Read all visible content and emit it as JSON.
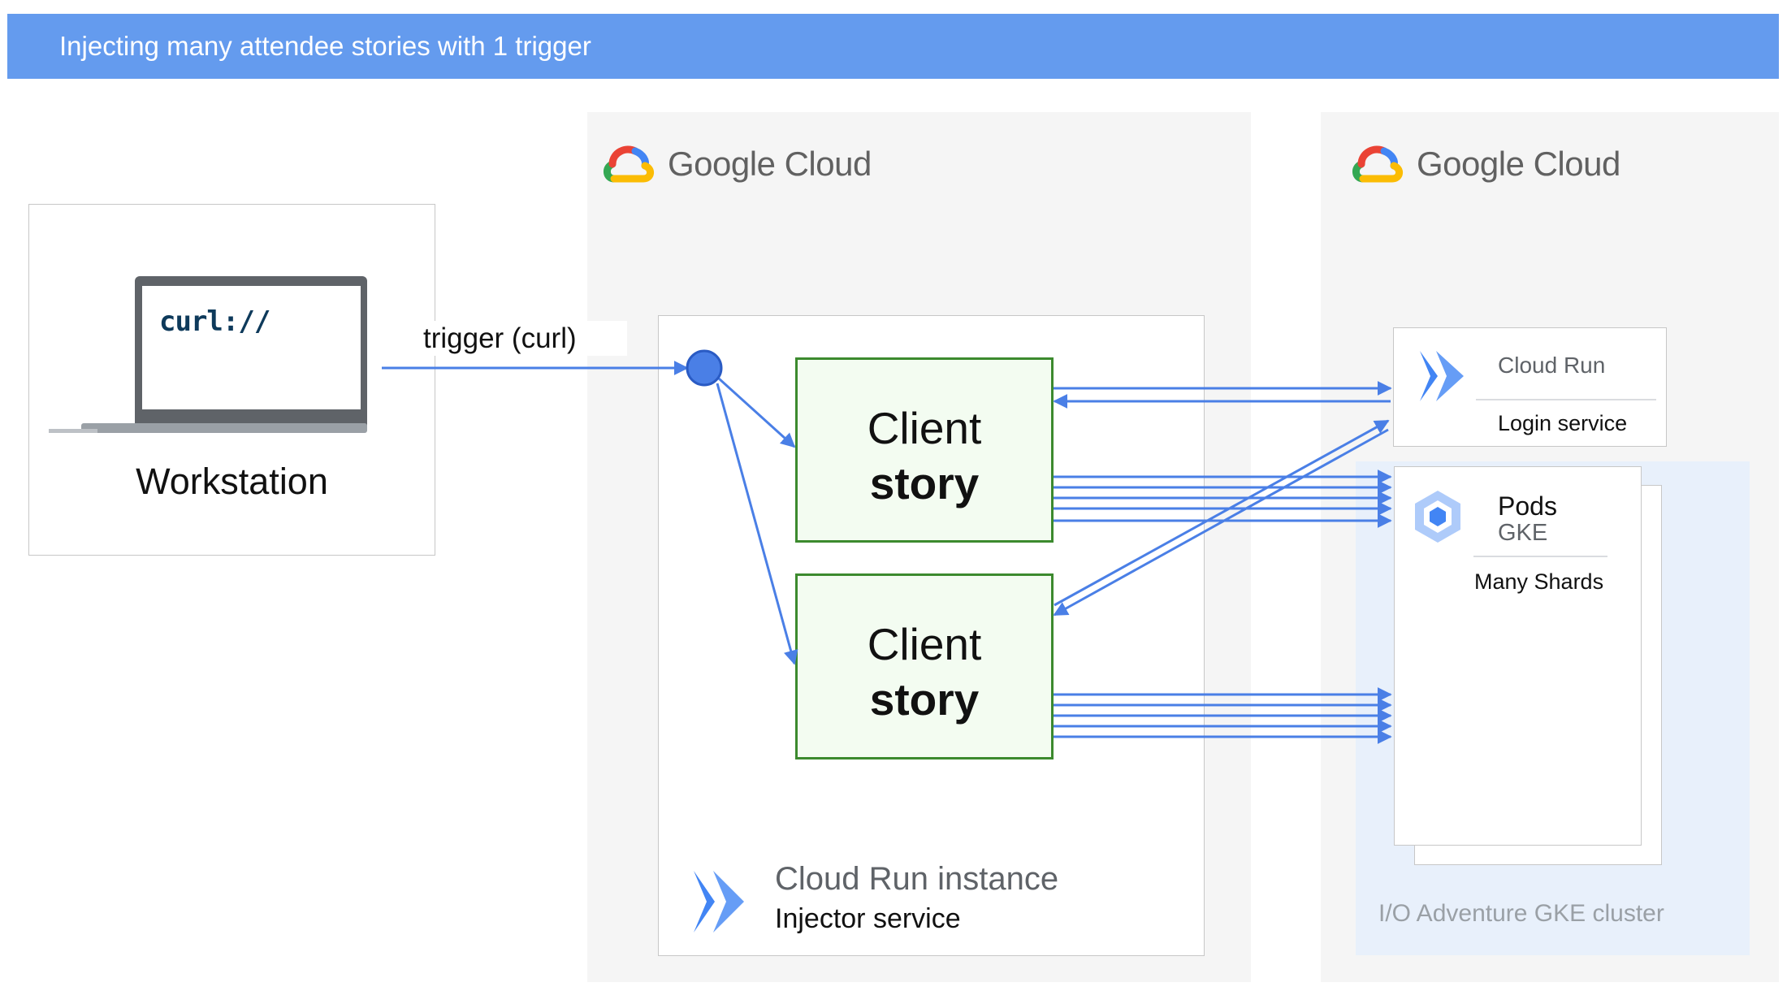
{
  "header": {
    "title": "Injecting many attendee stories with 1 trigger"
  },
  "workstation": {
    "label": "Workstation",
    "screen_text": "curl://"
  },
  "trigger": {
    "label": "trigger (curl)"
  },
  "injector_cloud": {
    "brand": "Google Cloud"
  },
  "target_cloud": {
    "brand": "Google Cloud"
  },
  "stories": [
    {
      "line1": "Client",
      "line2": "story"
    },
    {
      "line1": "Client",
      "line2": "story"
    }
  ],
  "injector": {
    "title": "Cloud Run instance",
    "subtitle": "Injector service"
  },
  "login": {
    "title": "Cloud Run",
    "subtitle": "Login service"
  },
  "pods": {
    "title": "Pods",
    "subtitle": "GKE",
    "detail": "Many Shards"
  },
  "cluster": {
    "label": "I/O Adventure GKE cluster"
  },
  "colors": {
    "header": "#649bee",
    "arrow": "#4a7fe6",
    "story_border": "#3c8a2e",
    "story_fill": "#f3fcf1",
    "cluster_fill": "#e8f0fb"
  },
  "icons": [
    "google-cloud-logo",
    "laptop-icon",
    "cloud-run-icon",
    "gke-icon"
  ]
}
